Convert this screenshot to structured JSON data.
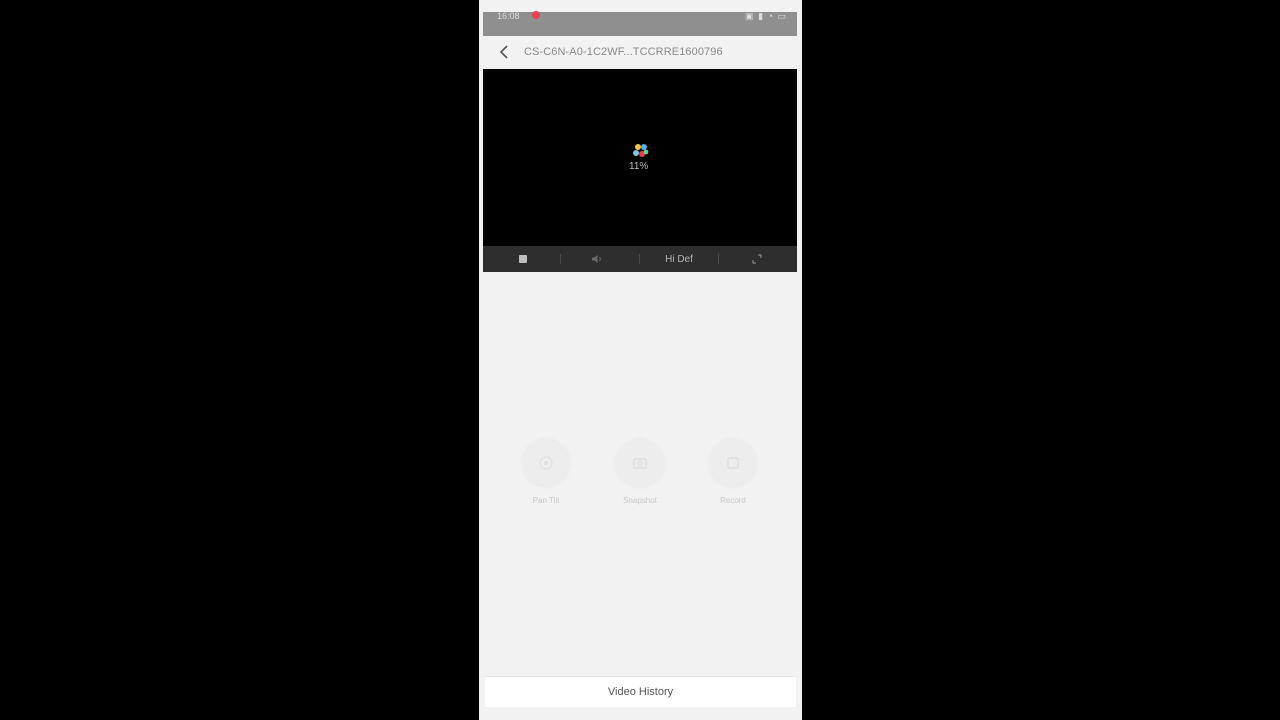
{
  "status_bar": {
    "time": "16:08",
    "icons": [
      "notification-icon",
      "signal-icon",
      "wifi-icon",
      "battery-icon"
    ],
    "accent": "#e8414f"
  },
  "header": {
    "title": "CS-C6N-A0-1C2WF...TCCRRE1600796"
  },
  "player": {
    "loading_percent": "11%",
    "definition_label": "Hi Def",
    "background": "#000000"
  },
  "actions": [
    {
      "label": "Pan Tilt",
      "icon": "pan-tilt-icon"
    },
    {
      "label": "Snapshot",
      "icon": "snapshot-icon"
    },
    {
      "label": "Record",
      "icon": "record-icon"
    }
  ],
  "footer": {
    "label": "Video History"
  }
}
